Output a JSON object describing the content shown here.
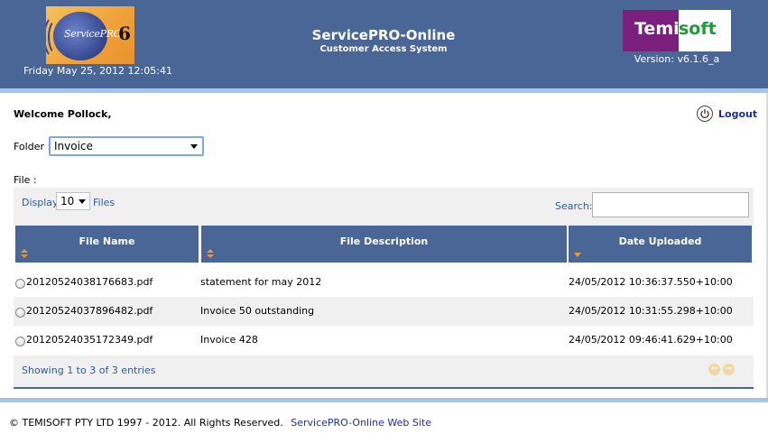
{
  "header": {
    "logo_text": "ServicePRO",
    "logo_number": "6",
    "date_time": "Friday May 25, 2012 12:05:41",
    "title": "ServicePRO-Online",
    "subtitle": "Customer Access System",
    "brand_logo_part1": "Temi",
    "brand_logo_part2": "soft",
    "version": "Version: v6.1.6_a",
    "colors": {
      "header_bg": "#4a6696",
      "stripe": "#a7c3ea",
      "brand_purple": "#7b1f7d",
      "brand_green": "#1e9a3a"
    }
  },
  "welcome": "Welcome Pollock,",
  "logout": {
    "label": "Logout",
    "icon": "power-icon"
  },
  "folder": {
    "label": "Folder :",
    "selected": "Invoice"
  },
  "file_label": "File :",
  "toolbar": {
    "display_label": "Display",
    "page_size": "10",
    "files_label": "Files",
    "search_label": "Search:",
    "search_value": ""
  },
  "table": {
    "columns": [
      "File Name",
      "File Description",
      "Date Uploaded"
    ],
    "rows": [
      [
        "20120524038176683.pdf",
        "statement for may 2012",
        "24/05/2012 10:36:37.550+10:00"
      ],
      [
        "20120524037896482.pdf",
        "Invoice 50 outstanding",
        "24/05/2012 10:31:55.298+10:00"
      ],
      [
        "20120524035172349.pdf",
        "Invoice 428",
        "24/05/2012 09:46:41.629+10:00"
      ]
    ]
  },
  "pagination": {
    "entries_text": "Showing 1 to 3 of 3 entries",
    "prev": "←",
    "next": "→"
  },
  "footer": {
    "copyright": "© TEMISOFT PTY LTD 1997 - 2012. All Rights Reserved.",
    "link": "ServicePRO-Online Web Site"
  }
}
